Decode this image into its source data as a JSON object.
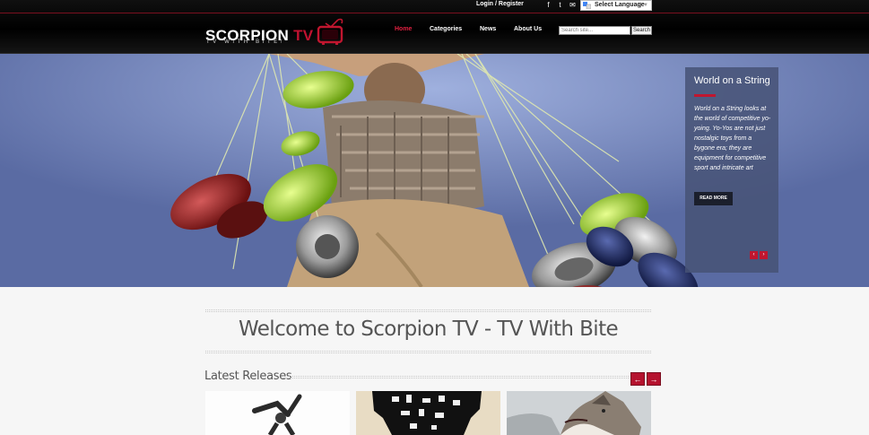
{
  "header": {
    "login_label": "Login / Register",
    "social_icons": [
      "facebook-icon",
      "twitter-icon",
      "email-icon"
    ],
    "social_glyphs": [
      "f",
      "t",
      "✉"
    ],
    "language_label": "Select Language",
    "logo": {
      "title_main": "SCORPION",
      "title_accent": "TV",
      "tagline": "TV WITH BITE!"
    },
    "nav": [
      "Home",
      "Categories",
      "News",
      "About Us"
    ],
    "search": {
      "placeholder": "Search site...",
      "button_label": "Search"
    }
  },
  "slider": {
    "caption_title": "World on a String",
    "caption_text": "World on a String looks at the world of competitive yo-yoing. Yo-Yos are not just nostalgic toys from a bygone era; they are equipment for competitive sport and intricate art",
    "read_more_label": "READ MORE",
    "prev_glyph": "‹",
    "next_glyph": "›"
  },
  "main": {
    "welcome_title": "Welcome to Scorpion TV - TV With Bite",
    "latest_title": "Latest Releases",
    "prev_glyph": "←",
    "next_glyph": "→",
    "thumbnails": [
      "release-thumbnail-1",
      "release-thumbnail-2",
      "release-thumbnail-3"
    ]
  },
  "colors": {
    "accent": "#c0162f",
    "header_bg": "#0a0a0a",
    "nav_active": "#e02040"
  }
}
